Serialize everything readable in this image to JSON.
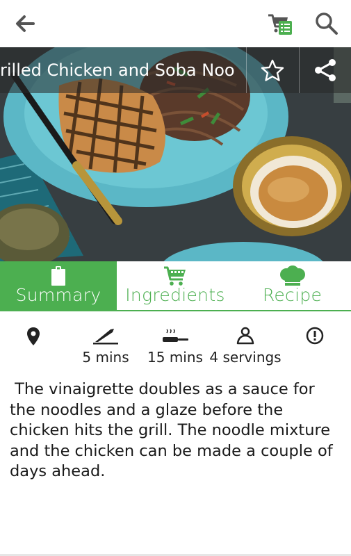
{
  "appbar": {
    "back_icon": "arrow-left-icon",
    "cart_icon": "shopping-list-cart-icon",
    "search_icon": "search-icon",
    "cart_accent": "#4caf50"
  },
  "hero": {
    "title": "Grilled Chicken and Soba Noodles",
    "title_visible": "rilled Chicken and Soba Noo",
    "star_icon": "star-outline-icon",
    "share_icon": "share-icon"
  },
  "tabs": [
    {
      "label": "Summary",
      "icon": "clipboard-icon",
      "active": true
    },
    {
      "label": "Ingredients",
      "icon": "shopping-cart-icon",
      "active": false
    },
    {
      "label": "Recipe",
      "icon": "chef-hat-icon",
      "active": false
    }
  ],
  "info": {
    "location_icon": "location-pin-icon",
    "prep_icon": "knife-cutting-board-icon",
    "prep_time": "5 mins",
    "cook_icon": "frying-pan-icon",
    "cook_time": "15 mins",
    "servings_icon": "person-icon",
    "servings": "4 servings",
    "alert_icon": "alert-circle-icon"
  },
  "description": "The vinaigrette doubles as a sauce for the noodles and a glaze before the chicken hits the grill. The noodle mixture and the chicken can be made a couple of days ahead.",
  "colors": {
    "accent": "#4caf50"
  }
}
